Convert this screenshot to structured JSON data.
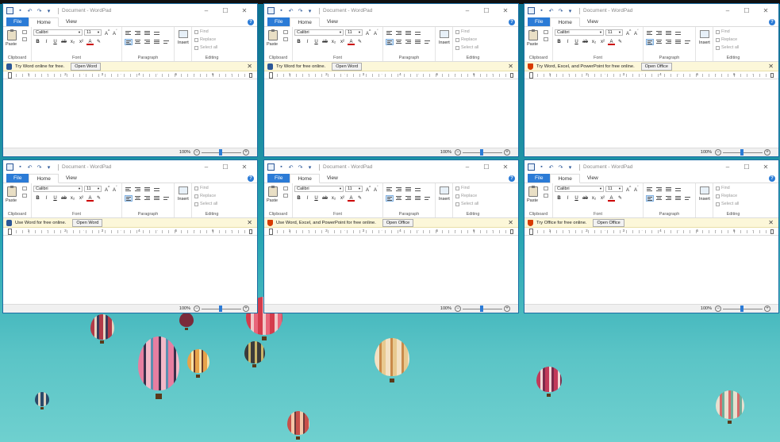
{
  "desktop": {
    "wallpaper_colors": [
      "#0b6f8c",
      "#2aa7b3",
      "#6fd0cf"
    ]
  },
  "windows": [
    {
      "title": "Document - WordPad",
      "message": "Try Word online for free.",
      "button": "Open Word",
      "msg_icon": "word-icon"
    },
    {
      "title": "Document - WordPad",
      "message": "Try Word for free online.",
      "button": "Open Word",
      "msg_icon": "word-icon"
    },
    {
      "title": "Document - WordPad",
      "message": "Try Word, Excel, and PowerPoint for free online.",
      "button": "Open Office",
      "msg_icon": "office-icon"
    },
    {
      "title": "Document - WordPad",
      "message": "Use Word for free online.",
      "button": "Open Word",
      "msg_icon": "word-icon"
    },
    {
      "title": "Document - WordPad",
      "message": "Use Word, Excel, and PowerPoint for free online.",
      "button": "Open Office",
      "msg_icon": "office-icon"
    },
    {
      "title": "Document - WordPad",
      "message": "Try Office for free online.",
      "button": "Open Office",
      "msg_icon": "office-icon"
    }
  ],
  "ribbon": {
    "tab_file": "File",
    "tab_home": "Home",
    "tab_view": "View",
    "paste": "Paste",
    "group_clipboard": "Clipboard",
    "group_font": "Font",
    "group_paragraph": "Paragraph",
    "group_editing": "Editing",
    "insert": "Insert",
    "font_name": "Calibri",
    "font_size": "11",
    "find": "Find",
    "replace": "Replace",
    "select_all": "Select all"
  },
  "status": {
    "zoom": "100%"
  },
  "accent_color": "#2b7bd6"
}
